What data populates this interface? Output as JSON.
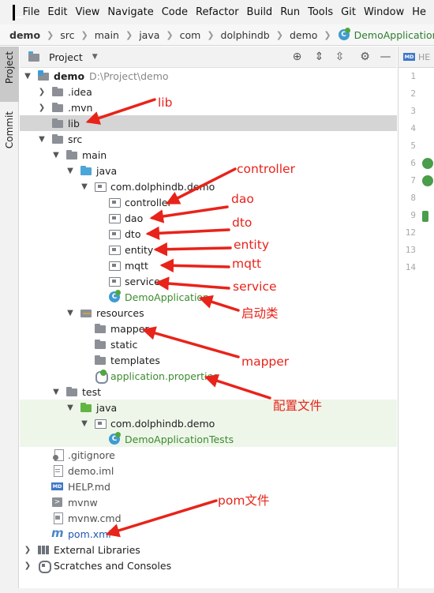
{
  "menu": [
    "File",
    "Edit",
    "View",
    "Navigate",
    "Code",
    "Refactor",
    "Build",
    "Run",
    "Tools",
    "Git",
    "Window",
    "He"
  ],
  "breadcrumb": [
    "demo",
    "src",
    "main",
    "java",
    "com",
    "dolphindb",
    "demo",
    "DemoApplication"
  ],
  "left_strip": {
    "project": "Project",
    "commit": "Commit"
  },
  "panel": {
    "title": "Project"
  },
  "editor": {
    "tab": "HE",
    "lines": [
      "1",
      "2",
      "3",
      "4",
      "5",
      "6",
      "7",
      "8",
      "9",
      "12",
      "13",
      "14"
    ]
  },
  "tree": {
    "demo": "demo",
    "demo_path": "D:\\Project\\demo",
    "idea": ".idea",
    "mvn": ".mvn",
    "lib": "lib",
    "src": "src",
    "main": "main",
    "java": "java",
    "pkg": "com.dolphindb.demo",
    "controller": "controller",
    "dao": "dao",
    "dto": "dto",
    "entity": "entity",
    "mqtt": "mqtt",
    "service": "service",
    "demo_app": "DemoApplication",
    "resources": "resources",
    "mapper": "mapper",
    "static": "static",
    "templates": "templates",
    "app_props": "application.properties",
    "test": "test",
    "test_java": "java",
    "test_pkg": "com.dolphindb.demo",
    "tests": "DemoApplicationTests",
    "gitignore": ".gitignore",
    "demo_iml": "demo.iml",
    "help": "HELP.md",
    "mvnw": "mvnw",
    "mvnw_cmd": "mvnw.cmd",
    "pom": "pom.xml",
    "ext_libs": "External Libraries",
    "scratches": "Scratches and Consoles"
  },
  "annotations": {
    "lib": "lib",
    "controller": "controller",
    "dao": "dao",
    "dto": "dto",
    "entity": "entity",
    "mqtt": "mqtt",
    "service": "service",
    "startup": "启动类",
    "mapper": "mapper",
    "config": "配置文件",
    "pom": "pom文件"
  },
  "colors": {
    "annotation": "#e8231a",
    "selection": "#d5d5d5",
    "test_bg": "#eef6ea",
    "class_text": "#3d8b2f",
    "pom_text": "#2058b3"
  }
}
